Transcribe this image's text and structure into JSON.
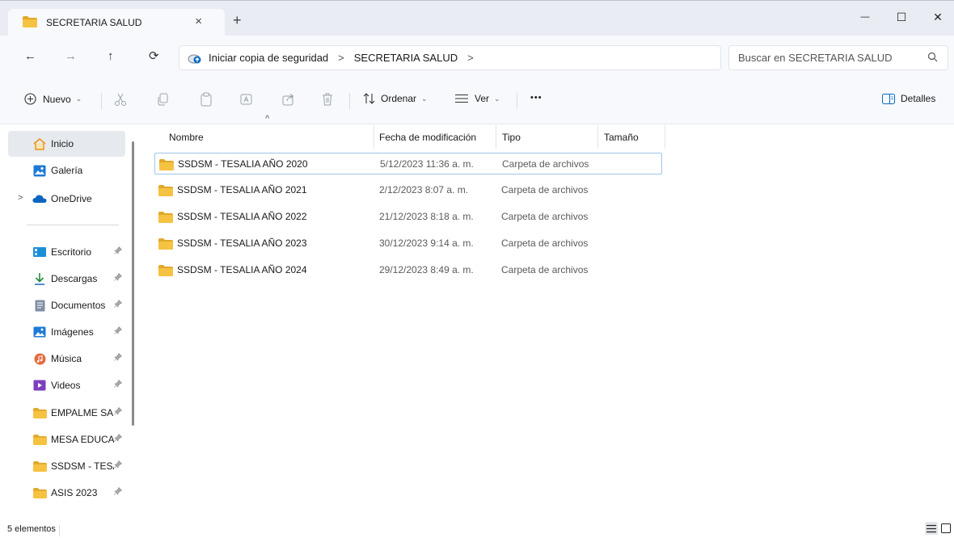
{
  "tab": {
    "title": "SECRETARIA SALUD",
    "close_glyph": "×",
    "new_glyph": "+"
  },
  "window": {
    "minimize_glyph": "—",
    "maximize_glyph": "☐",
    "close_glyph": "✕"
  },
  "nav": {
    "back_glyph": "←",
    "forward_glyph": "→",
    "up_glyph": "↑",
    "refresh_glyph": "⟳"
  },
  "address": {
    "segments": [
      "Iniciar copia de seguridad",
      "SECRETARIA SALUD"
    ],
    "separator": ">"
  },
  "search": {
    "placeholder": "Buscar en SECRETARIA SALUD"
  },
  "toolbar": {
    "new_label": "Nuevo",
    "sort_label": "Ordenar",
    "view_label": "Ver",
    "more_glyph": "•••",
    "details_label": "Detalles",
    "chevron": "⌄"
  },
  "sidebar": {
    "items": [
      {
        "label": "Inicio",
        "icon": "home-icon"
      },
      {
        "label": "Galería",
        "icon": "gallery-icon"
      },
      {
        "label": "OneDrive",
        "icon": "cloud-icon"
      },
      {
        "label": "Escritorio",
        "icon": "desktop-icon"
      },
      {
        "label": "Descargas",
        "icon": "download-icon"
      },
      {
        "label": "Documentos",
        "icon": "document-icon"
      },
      {
        "label": "Imágenes",
        "icon": "pictures-icon"
      },
      {
        "label": "Música",
        "icon": "music-icon"
      },
      {
        "label": "Videos",
        "icon": "video-icon"
      },
      {
        "label": "EMPALME SALUD",
        "icon": "folder-icon"
      },
      {
        "label": "MESA EDUCATIVA",
        "icon": "folder-icon"
      },
      {
        "label": "SSDSM - TESALIA",
        "icon": "folder-icon"
      },
      {
        "label": "ASIS 2023",
        "icon": "folder-icon"
      }
    ],
    "expander_glyph": ">",
    "pin_glyph": "📌"
  },
  "columns": {
    "name": "Nombre",
    "date": "Fecha de modificación",
    "type": "Tipo",
    "size": "Tamaño",
    "sort_glyph": "^"
  },
  "rows": [
    {
      "name": "SSDSM - TESALIA AÑO 2020",
      "date": "5/12/2023 11:36 a. m.",
      "type": "Carpeta de archivos"
    },
    {
      "name": "SSDSM - TESALIA AÑO 2021",
      "date": "2/12/2023 8:07 a. m.",
      "type": "Carpeta de archivos"
    },
    {
      "name": "SSDSM - TESALIA AÑO 2022",
      "date": "21/12/2023 8:18 a. m.",
      "type": "Carpeta de archivos"
    },
    {
      "name": "SSDSM - TESALIA AÑO 2023",
      "date": "30/12/2023 9:14 a. m.",
      "type": "Carpeta de archivos"
    },
    {
      "name": "SSDSM - TESALIA AÑO 2024",
      "date": "29/12/2023 8:49 a. m.",
      "type": "Carpeta de archivos"
    }
  ],
  "status": {
    "count": "5 elementos"
  },
  "colors": {
    "folder": "#f5c242",
    "folder_dark": "#e0a92a",
    "accent": "#0a6cc4",
    "selection_border": "#9fc6ea"
  }
}
